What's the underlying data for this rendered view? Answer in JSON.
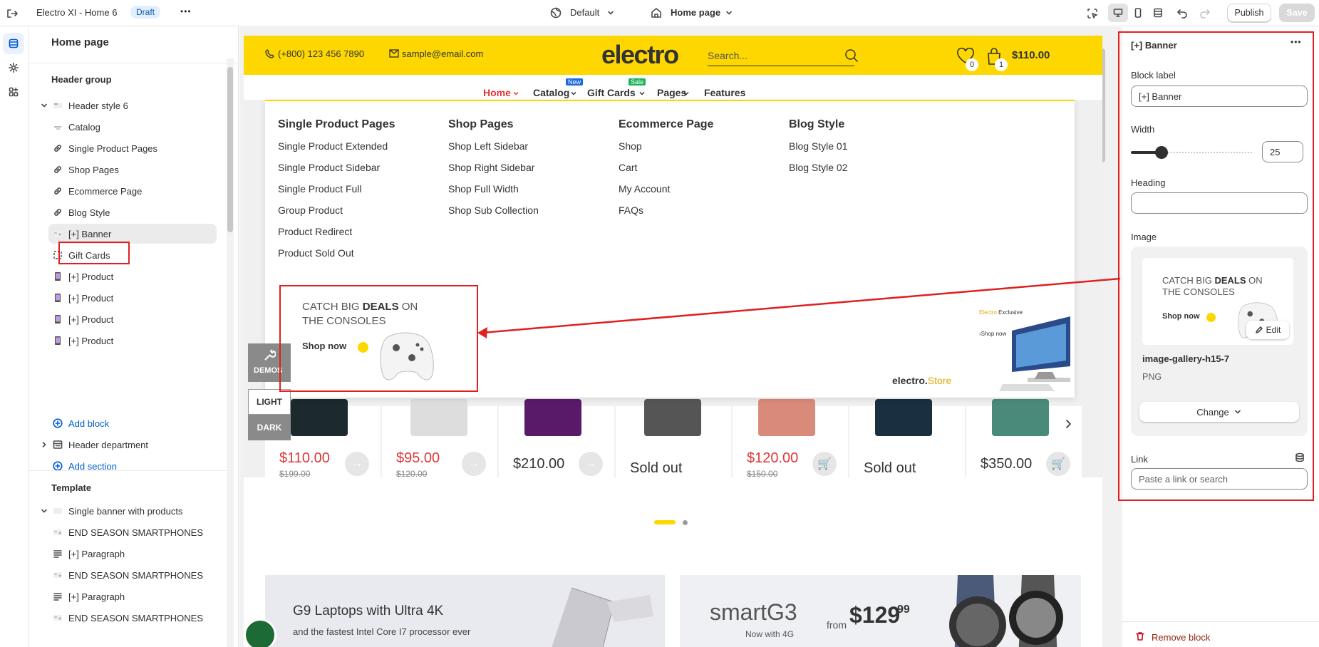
{
  "topbar": {
    "theme_name": "Electro XI - Home 6",
    "status_badge": "Draft",
    "more_label": "•••",
    "preset_label": "Default",
    "page_label": "Home page",
    "publish_label": "Publish",
    "save_label": "Save"
  },
  "sidebar": {
    "title": "Home page",
    "header_group_title": "Header group",
    "header_section": "Header style 6",
    "header_blocks": [
      {
        "label": "Catalog",
        "icon": "block-icon"
      },
      {
        "label": "Single Product Pages",
        "icon": "link-icon"
      },
      {
        "label": "Shop Pages",
        "icon": "link-icon"
      },
      {
        "label": "Ecommerce Page",
        "icon": "link-icon"
      },
      {
        "label": "Blog Style",
        "icon": "link-icon"
      },
      {
        "label": "[+] Banner",
        "icon": "image-thumb-icon"
      },
      {
        "label": "Gift Cards",
        "icon": "dashed-square-icon"
      },
      {
        "label": "[+] Product",
        "icon": "product-thumb-icon"
      },
      {
        "label": "[+] Product",
        "icon": "product-thumb-icon"
      },
      {
        "label": "[+] Product",
        "icon": "product-thumb-icon"
      },
      {
        "label": "[+] Product",
        "icon": "product-thumb-icon"
      }
    ],
    "add_block_label": "Add block",
    "header_department": "Header department",
    "add_section_label": "Add section",
    "template_title": "Template",
    "template_section": "Single banner with products",
    "template_blocks": [
      {
        "label": "END SEASON SMARTPHONES",
        "icon": "image-thumb-icon"
      },
      {
        "label": "[+] Paragraph",
        "icon": "paragraph-icon"
      },
      {
        "label": "END SEASON SMARTPHONES",
        "icon": "image-thumb-icon"
      },
      {
        "label": "[+] Paragraph",
        "icon": "paragraph-icon"
      },
      {
        "label": "END SEASON SMARTPHONES",
        "icon": "image-thumb-icon"
      }
    ]
  },
  "store": {
    "phone": "(+800) 123 456 7890",
    "email": "sample@email.com",
    "logo": "electro",
    "search_placeholder": "Search...",
    "wishlist_count": "0",
    "cart_count": "1",
    "cart_total": "$110.00",
    "nav": [
      {
        "label": "Home",
        "badge": ""
      },
      {
        "label": "Catalog",
        "badge": "New"
      },
      {
        "label": "Gift Cards",
        "badge": "Sale"
      },
      {
        "label": "Pages",
        "badge": ""
      },
      {
        "label": "Features",
        "badge": ""
      }
    ],
    "mega_menu": [
      {
        "title": "Single Product Pages",
        "links": [
          "Single Product Extended",
          "Single Product Sidebar",
          "Single Product Full",
          "Group Product",
          "Product Redirect",
          "Product Sold Out"
        ]
      },
      {
        "title": "Shop Pages",
        "links": [
          "Shop Left Sidebar",
          "Shop Right Sidebar",
          "Shop Full Width",
          "Shop Sub Collection"
        ]
      },
      {
        "title": "Ecommerce Page",
        "links": [
          "Shop",
          "Cart",
          "My Account",
          "FAQs"
        ]
      },
      {
        "title": "Blog Style",
        "links": [
          "Blog Style 01",
          "Blog Style 02"
        ]
      }
    ],
    "banner": {
      "line1": "CATCH BIG",
      "bold": "DEALS",
      "line1_end": "ON",
      "line2": "THE CONSOLES",
      "cta": "Shop now"
    },
    "exclusive": {
      "brand": "Electro",
      "tag": "Exclusive",
      "cta": "›Shop now",
      "store_logo": "electro.",
      "store_logo_suffix": "Store"
    },
    "demos_label": "DEMOS",
    "light_label": "LIGHT",
    "dark_label": "DARK",
    "products": [
      {
        "price": "$110.00",
        "old": "$199.00",
        "sale": true
      },
      {
        "price": "$95.00",
        "old": "$120.00",
        "sale": true
      },
      {
        "price": "$210.00",
        "old": "",
        "sale": false
      },
      {
        "price": "Sold out",
        "old": "",
        "sale": false
      },
      {
        "price": "$120.00",
        "old": "$150.00",
        "sale": true
      },
      {
        "price": "Sold out",
        "old": "",
        "sale": false
      },
      {
        "price": "$350.00",
        "old": "",
        "sale": false
      }
    ],
    "promo1": {
      "title": "G9 Laptops with Ultra 4K",
      "sub": "and the fastest Intel Core I7 processor ever"
    },
    "promo2": {
      "brand": "smartG3",
      "sub": "Now with 4G",
      "from": "from",
      "price": "$129",
      "cents": "99"
    }
  },
  "panel": {
    "title": "[+] Banner",
    "block_label_label": "Block label",
    "block_label_value": "[+] Banner",
    "width_label": "Width",
    "width_value": "25",
    "width_fraction": 0.25,
    "heading_label": "Heading",
    "heading_value": "",
    "image_label": "Image",
    "edit_label": "Edit",
    "image_name": "image-gallery-h15-7",
    "image_type": "PNG",
    "change_label": "Change",
    "link_label": "Link",
    "link_placeholder": "Paste a link or search",
    "remove_label": "Remove block"
  },
  "colors": {
    "accent": "#fed700",
    "annotation": "#e02020",
    "sale": "#df3737",
    "link_blue": "#005bd3"
  }
}
